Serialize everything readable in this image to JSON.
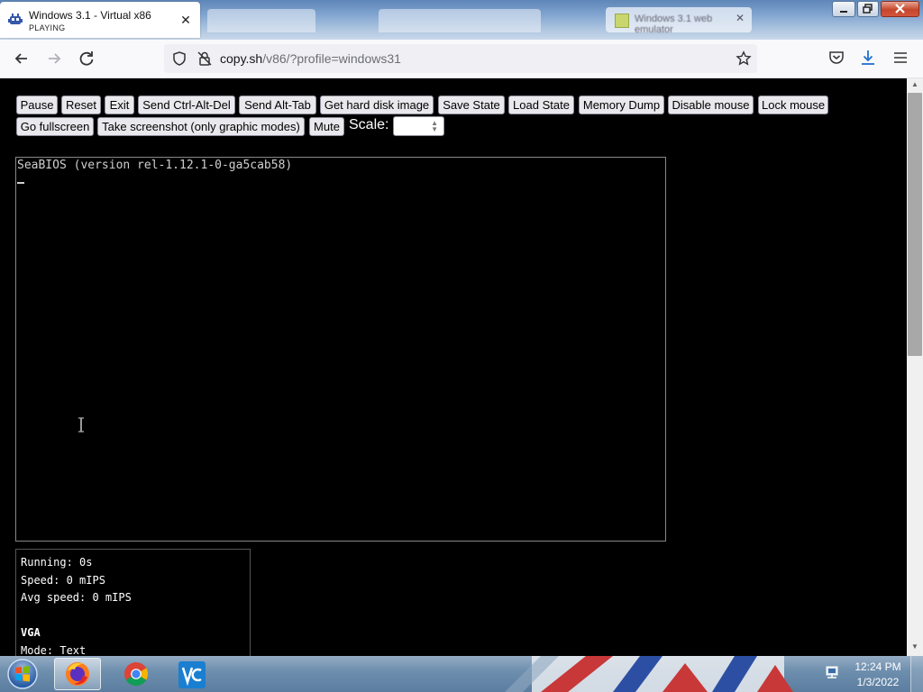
{
  "browser": {
    "active_tab": {
      "title": "Windows 3.1 - Virtual x86",
      "subtitle": "PLAYING",
      "close": "✕"
    },
    "other_tab": {
      "title": "Windows 3.1 web emulator",
      "close": "✕"
    },
    "url": {
      "domain": "copy.sh",
      "path": "/v86/?profile=windows31"
    }
  },
  "emulator": {
    "buttons_row1": [
      "Pause",
      "Reset",
      "Exit",
      "Send Ctrl-Alt-Del",
      "Send Alt-Tab",
      "Get hard disk image",
      "Save State",
      "Load State",
      "Memory Dump",
      "Disable mouse",
      "Lock mouse"
    ],
    "buttons_row2": [
      "Go fullscreen",
      "Take screenshot (only graphic modes)",
      "Mute"
    ],
    "scale_label": "Scale:",
    "scale_value": "",
    "screen_text": "SeaBIOS (version rel-1.12.1-0-ga5cab58)",
    "stats": {
      "running": "Running: 0s",
      "speed": "Speed: 0 mIPS",
      "avg_speed": "Avg speed: 0 mIPS",
      "vga_header": "VGA",
      "mode": "Mode: Text"
    }
  },
  "taskbar": {
    "apps": [
      "firefox-icon",
      "chrome-icon",
      "vnc-icon"
    ],
    "clock_time": "12:24 PM",
    "clock_date": "1/3/2022"
  },
  "colors": {
    "page_bg": "#000000",
    "button_bg": "#e9e9ed",
    "bios_text": "#cfcfcf"
  }
}
